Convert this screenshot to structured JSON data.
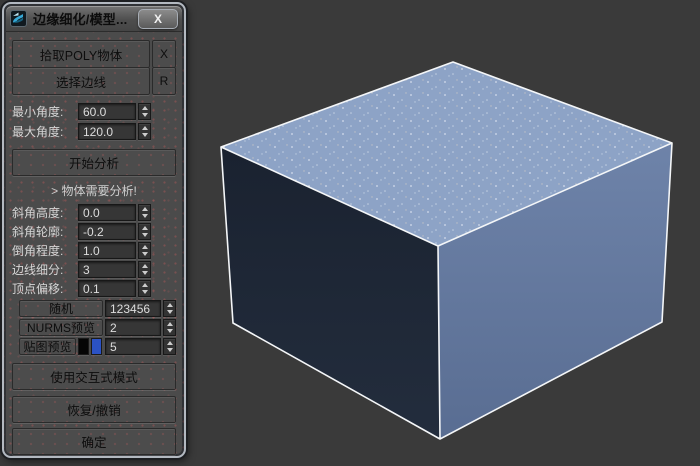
{
  "window": {
    "title": "边缘细化/模型...",
    "close_glyph": "X"
  },
  "buttons": {
    "pick_poly": "拾取POLY物体",
    "pick_poly_key": "X",
    "select_edges": "选择边线",
    "select_edges_key": "R",
    "analyze": "开始分析",
    "random": "随机",
    "nurms_preview": "NURMS预览",
    "map_preview": "贴图预览",
    "interactive": "使用交互式模式",
    "restore_undo": "恢复/撤销",
    "ok": "确定"
  },
  "status": {
    "message": "> 物体需要分析!"
  },
  "controls": {
    "min_angle": {
      "label": "最小角度:",
      "value": "60.0"
    },
    "max_angle": {
      "label": "最大角度:",
      "value": "120.0"
    },
    "bevel_height": {
      "label": "斜角高度:",
      "value": "0.0"
    },
    "bevel_outline": {
      "label": "斜角轮廓:",
      "value": "-0.2"
    },
    "chamfer_amount": {
      "label": "倒角程度:",
      "value": "1.0"
    },
    "edge_segments": {
      "label": "边线细分:",
      "value": "3"
    },
    "vertex_offset": {
      "label": "顶点偏移:",
      "value": "0.1"
    },
    "random_seed": {
      "value": "123456"
    },
    "nurms_iterations": {
      "value": "2"
    },
    "map_channel": {
      "value": "5",
      "swatch_black": "#050505",
      "swatch_blue": "#2b52c4"
    }
  },
  "viewport": {
    "background": "#3a3a3a",
    "box": {
      "top": "#8da3c6",
      "front_top": "#1a2230",
      "front_bottom": "#232d3d",
      "right_top": "#6e83a9",
      "right_bottom": "#596d92",
      "edge": "#f4f6f8"
    }
  }
}
